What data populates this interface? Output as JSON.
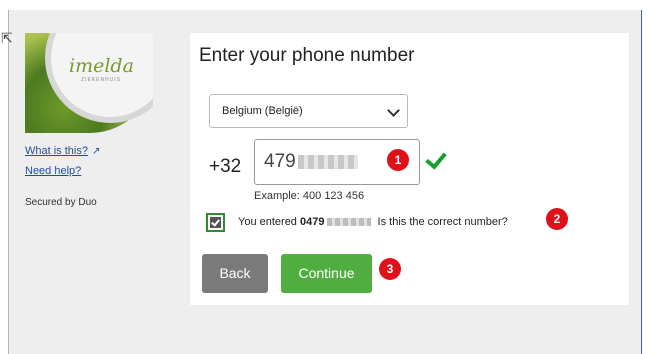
{
  "brand": {
    "logo_text": "imelda",
    "logo_subtext": "ZIEKENHUIS"
  },
  "sidebar": {
    "what_is_this": "What is this?",
    "need_help": "Need help?",
    "secured_by": "Secured by Duo"
  },
  "form": {
    "title": "Enter your phone number",
    "country": "Belgium (België)",
    "prefix": "+32",
    "phone_value": "479",
    "example": "Example: 400 123 456",
    "confirm_prefix": "You entered",
    "confirm_number": "0479",
    "confirm_suffix": "Is this the correct number?",
    "confirm_checked": true
  },
  "buttons": {
    "back": "Back",
    "continue": "Continue"
  },
  "markers": [
    "1",
    "2",
    "3"
  ],
  "colors": {
    "continue_bg": "#4fae3f",
    "back_bg": "#7a7a7a",
    "marker_red": "#e0101a",
    "check_green": "#1a9e2f",
    "link_blue": "#1f4e9c"
  }
}
